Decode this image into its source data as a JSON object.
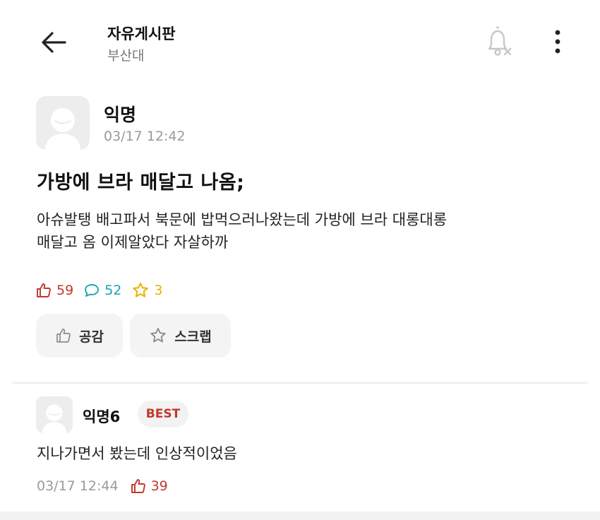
{
  "header": {
    "board_title": "자유게시판",
    "school": "부산대",
    "back_icon": "arrow-left-icon",
    "bell_icon": "bell-off-icon",
    "more_icon": "more-vertical-icon"
  },
  "post": {
    "author": "익명",
    "time": "03/17 12:42",
    "title": "가방에 브라 매달고 나옴;",
    "body": "아슈발탱 배고파서 북문에 밥먹으러나왔는데 가방에 브라 대롱대롱\n매달고 옴 이제알았다 자살하까",
    "stats": {
      "likes": "59",
      "comments": "52",
      "scraps": "3"
    },
    "actions": {
      "like_label": "공감",
      "scrap_label": "스크랩"
    }
  },
  "comment": {
    "author": "익명6",
    "badge": "BEST",
    "body": "지나가면서 봤는데 인상적이었음",
    "time": "03/17 12:44",
    "likes": "39"
  },
  "colors": {
    "like": "#c0392b",
    "comment": "#1aa3b8",
    "scrap": "#e5b400",
    "muted": "#9a9a9a"
  }
}
